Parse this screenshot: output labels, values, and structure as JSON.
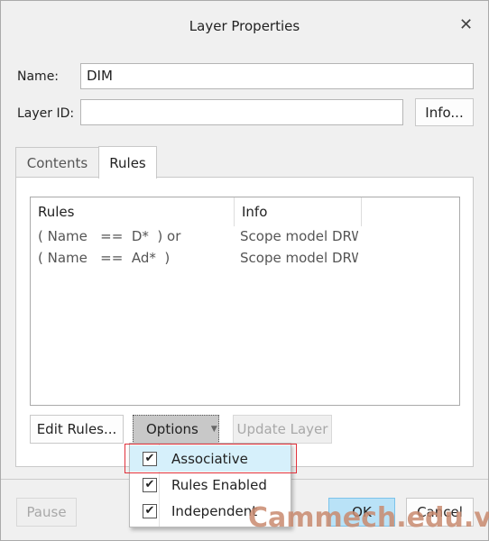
{
  "window": {
    "title": "Layer Properties",
    "close_icon": "close-icon"
  },
  "form": {
    "name_label": "Name:",
    "name_value": "DIM",
    "layer_id_label": "Layer ID:",
    "layer_id_value": "",
    "info_button": "Info..."
  },
  "tabs": [
    {
      "label": "Contents",
      "active": false
    },
    {
      "label": "Rules",
      "active": true
    }
  ],
  "rules_table": {
    "columns": [
      "Rules",
      "Info"
    ],
    "rows": [
      {
        "rule": "( Name   ==  D*  ) or",
        "info": "Scope model DRW"
      },
      {
        "rule": "( Name   ==  Ad*  )",
        "info": "Scope model DRW"
      }
    ]
  },
  "rules_buttons": {
    "edit": "Edit Rules...",
    "options": "Options",
    "update": "Update Layer"
  },
  "options_menu": [
    {
      "label": "Associative",
      "checked": true,
      "highlighted": true
    },
    {
      "label": "Rules Enabled",
      "checked": true
    },
    {
      "label": "Independent",
      "checked": true
    }
  ],
  "footer": {
    "pause": "Pause",
    "ok": "OK",
    "cancel": "Cancel"
  },
  "watermark": "Cammech.edu.vn",
  "colors": {
    "highlight": "#d6f0fb",
    "ok_button": "#b9e2f7",
    "annotation_box": "#e0303a"
  }
}
